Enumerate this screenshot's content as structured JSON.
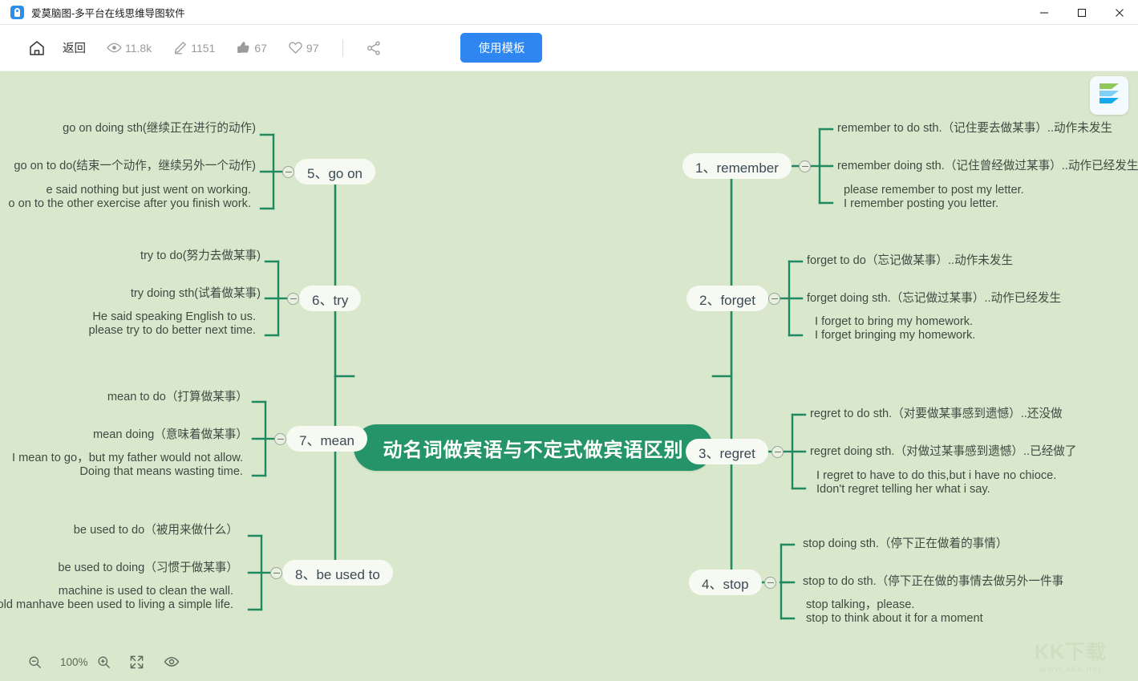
{
  "window": {
    "title": "爱莫脑图-多平台在线思维导图软件",
    "app_icon": "app-logo-icon",
    "controls": {
      "minimize": "minimize-icon",
      "maximize": "maximize-icon",
      "close": "close-icon"
    }
  },
  "toolbar": {
    "home_icon": "home-icon",
    "back_label": "返回",
    "stats": [
      {
        "icon": "eye-icon",
        "name": "views",
        "value": "11.8k"
      },
      {
        "icon": "pencil-icon",
        "name": "edits",
        "value": "1151"
      },
      {
        "icon": "thumbs-up-icon",
        "name": "likes",
        "value": "67"
      },
      {
        "icon": "heart-icon",
        "name": "favs",
        "value": "97"
      }
    ],
    "share_icon": "share-icon",
    "use_template_label": "使用模板"
  },
  "canvas": {
    "logo_icon": "brand-logo-icon",
    "center": {
      "title": "动名词做宾语与不定式做宾语区别"
    },
    "branches_right": [
      {
        "title": "1、remember",
        "leaves": [
          {
            "line1": "remember to do sth.（记住要去做某事）..动作未发生"
          },
          {
            "line1": "remember doing sth.（记住曾经做过某事）..动作已经发生"
          },
          {
            "line1": "please remember to post my letter.",
            "line2": "I remember posting you letter."
          }
        ]
      },
      {
        "title": "2、forget",
        "leaves": [
          {
            "line1": "forget to do（忘记做某事）..动作未发生"
          },
          {
            "line1": "forget doing sth.（忘记做过某事）..动作已经发生"
          },
          {
            "line1": "I forget to bring my homework.",
            "line2": "I forget  bringing my homework."
          }
        ]
      },
      {
        "title": "3、regret",
        "leaves": [
          {
            "line1": "regret to do sth.（对要做某事感到遗憾）..还没做"
          },
          {
            "line1": "regret doing sth.（对做过某事感到遗憾）..已经做了"
          },
          {
            "line1": "I regret to have to do this,but i have no chioce.",
            "line2": "Idon't regret telling her what i say."
          }
        ]
      },
      {
        "title": "4、stop",
        "leaves": [
          {
            "line1": "stop doing sth.（停下正在做着的事情）"
          },
          {
            "line1": "stop to do sth.（停下正在做的事情去做另外一件事"
          },
          {
            "line1": "stop talking，please.",
            "line2": "stop to think about it for a moment"
          }
        ]
      }
    ],
    "branches_left": [
      {
        "title": "5、go on",
        "leaves": [
          {
            "line1": "go on doing sth(继续正在进行的动作)"
          },
          {
            "line1": "go on to do(结束一个动作，继续另外一个动作)"
          },
          {
            "line1": "e said nothing but just went on working.",
            "line2": "o on to the other exercise after you finish work."
          }
        ]
      },
      {
        "title": "6、try",
        "leaves": [
          {
            "line1": "try to do(努力去做某事)"
          },
          {
            "line1": "try doing sth(试着做某事)"
          },
          {
            "line1": "He said speaking English to us.",
            "line2": "please try to do better next time."
          }
        ]
      },
      {
        "title": "7、mean",
        "leaves": [
          {
            "line1": "mean to do（打算做某事）"
          },
          {
            "line1": "mean doing（意味着做某事）"
          },
          {
            "line1": "I mean to go，but my father would not allow.",
            "line2": "Doing that means wasting time."
          }
        ]
      },
      {
        "title": "8、be used to",
        "leaves": [
          {
            "line1": "be used to do（被用来做什么）"
          },
          {
            "line1": "be used to doing（习惯于做某事）"
          },
          {
            "line1": "machine is used to clean the wall.",
            "line2": "old manhave been used to living a simple life."
          }
        ]
      }
    ]
  },
  "bottombar": {
    "zoom_out_icon": "zoom-out-icon",
    "zoom_level": "100%",
    "zoom_in_icon": "zoom-in-icon",
    "fit_icon": "fit-screen-icon",
    "preview_icon": "eye-icon"
  },
  "watermark": {
    "top": "KK下载",
    "bottom": "www.kkx.net"
  },
  "colors": {
    "canvas_bg": "#d9e8cd",
    "branch_line": "#1f8a5f",
    "center_fill": "#259469",
    "accent_button": "#2f86f0"
  }
}
